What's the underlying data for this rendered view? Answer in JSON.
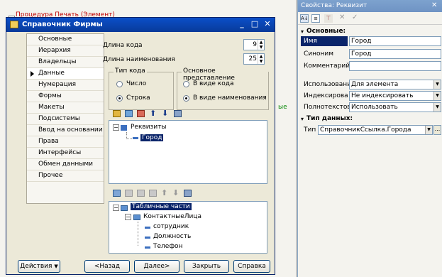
{
  "editor": {
    "code_line": "Процедура  Печать (Элемент)",
    "side_text": "ые"
  },
  "window": {
    "title": "Справочник Фирмы",
    "minimize": "_",
    "maximize": "□",
    "close": "✕"
  },
  "nav": {
    "items": [
      {
        "label": "Основные"
      },
      {
        "label": "Иерархия"
      },
      {
        "label": "Владельцы"
      },
      {
        "label": "Данные"
      },
      {
        "label": "Нумерация"
      },
      {
        "label": "Формы"
      },
      {
        "label": "Макеты"
      },
      {
        "label": "Подсистемы"
      },
      {
        "label": "Ввод на основании"
      },
      {
        "label": "Права"
      },
      {
        "label": "Интерфейсы"
      },
      {
        "label": "Обмен данными"
      },
      {
        "label": "Прочее"
      }
    ]
  },
  "data_tab": {
    "code_length_label": "Длина кода",
    "code_length_value": "9",
    "name_length_label": "Длина наименования",
    "name_length_value": "25",
    "code_type": {
      "title": "Тип кода",
      "option_number": "Число",
      "option_string": "Строка",
      "selected": "Строка"
    },
    "main_repr": {
      "title": "Основное представление",
      "option_code": "В виде кода",
      "option_name": "В виде наименования",
      "selected": "В виде наименования"
    },
    "attributes_tree": {
      "root": "Реквизиты",
      "child": "Город"
    },
    "tables_tree": {
      "root": "Табличные части",
      "table": "КонтактныеЛица",
      "fields": [
        "сотрудник",
        "Должность",
        "Телефон"
      ]
    }
  },
  "buttons": {
    "actions": "Действия",
    "back": "<Назад",
    "next": "Далее>",
    "close": "Закрыть",
    "help": "Справка"
  },
  "props": {
    "title": "Свойства: Реквизит",
    "section_main": "Основные:",
    "name_label": "Имя",
    "name_value": "Город",
    "synonym_label": "Синоним",
    "synonym_value": "Город",
    "comment_label": "Комментарий",
    "comment_value": "",
    "usage_label": "Использовани",
    "usage_value": "Для элемента",
    "index_label": "Индексирова",
    "index_value": "Не индексировать",
    "fulltext_label": "Полнотекстов",
    "fulltext_value": "Использовать",
    "section_type": "Тип данных:",
    "type_label": "Тип",
    "type_value": "СправочникСсылка.Города",
    "more_btn": "..."
  },
  "colors": {
    "title_blue": "#0b4fc8",
    "selection": "#0a246a",
    "props_title": "#7da2ce"
  }
}
